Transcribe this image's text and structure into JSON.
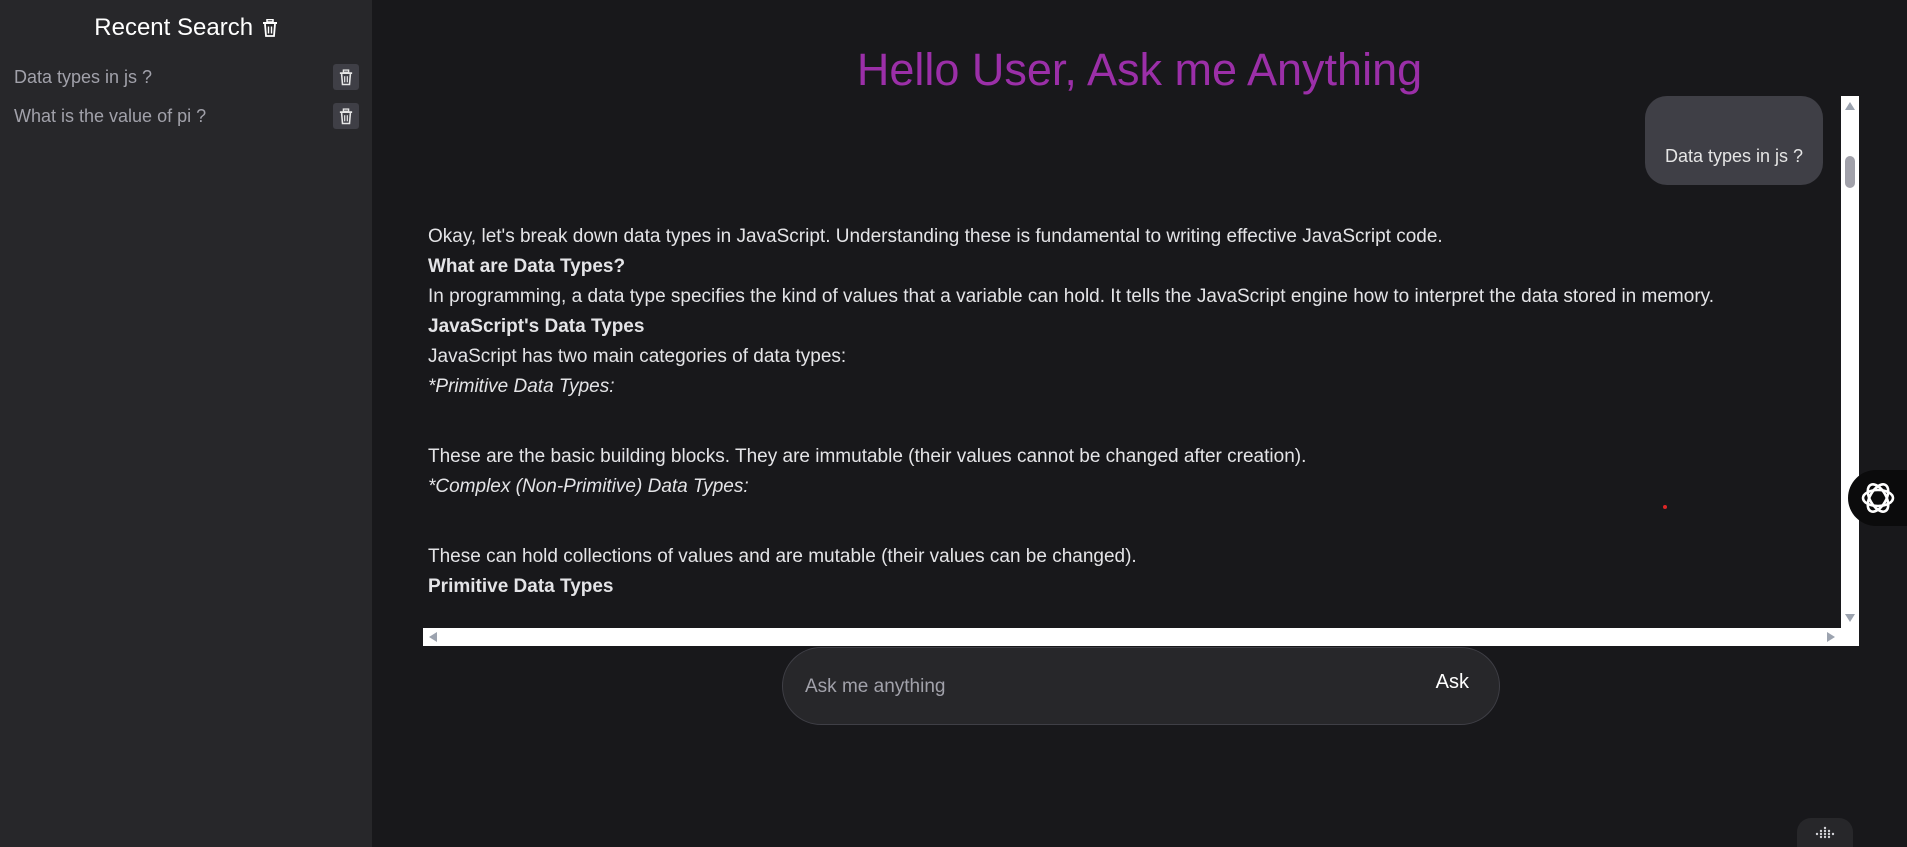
{
  "sidebar": {
    "title": "Recent Search",
    "clear_icon": "trash-icon",
    "items": [
      {
        "label": "Data types in js ?",
        "icon": "trash-icon"
      },
      {
        "label": "What is the value of pi ?",
        "icon": "trash-icon"
      }
    ]
  },
  "main": {
    "title": "Hello User, Ask me Anything",
    "title_color": "#9b2fa8",
    "user_message": "Data types in js ?",
    "answer": {
      "intro": "Okay, let's break down data types in JavaScript. Understanding these is fundamental to writing effective JavaScript code.",
      "heading_1": "What are Data Types?",
      "para_1": "In programming, a data type specifies the kind of values that a variable can hold. It tells the JavaScript engine how to interpret the data stored in memory.",
      "heading_2": "JavaScript's Data Types",
      "para_2": "JavaScript has two main categories of data types:",
      "primitive_label": "*Primitive Data Types:",
      "primitive_desc": "These are the basic building blocks. They are immutable (their values cannot be changed after creation).",
      "complex_label": "*Complex (Non-Primitive) Data Types:",
      "complex_desc": "These can hold collections of values and are mutable (their values can be changed).",
      "heading_3": "Primitive Data Types"
    }
  },
  "input": {
    "placeholder": "Ask me anything",
    "value": "",
    "button_label": "Ask"
  },
  "widgets": {
    "ai_assistant_icon": "openai-logo-icon",
    "corner_icon": "dots-grid-icon"
  }
}
